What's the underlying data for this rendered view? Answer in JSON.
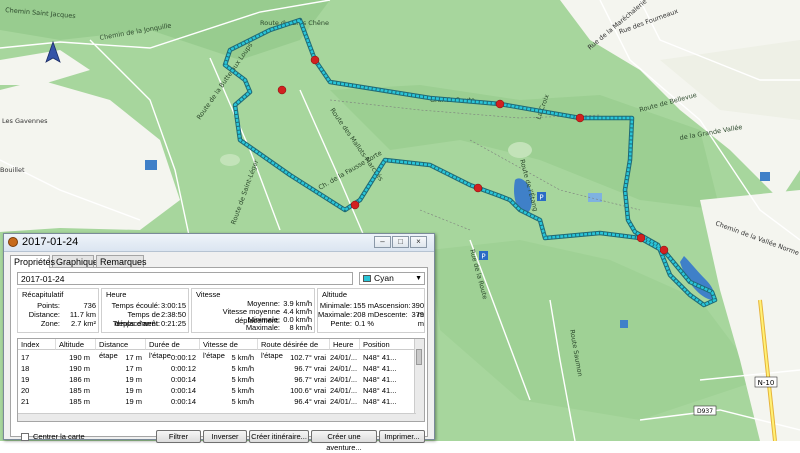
{
  "map": {
    "labels": {
      "saint_jacques": "Chemin Saint Jacques",
      "jonquilles": "Chemin de la Jonquille",
      "route_nord": "Route du Gros Chêne",
      "rue_martrelle": "Rue de la Maréchalerie",
      "rue_fourneaux": "Rue des Fourneaux",
      "route_marche": "Route des Mallots-Marchés",
      "butte_aux_loups": "Route de la Butte aux Loups",
      "fausse_porte": "Ch. de la Fausse Porte",
      "route_bellevue": "Route de Bellevue",
      "chemin_vallee": "Chemin de la Vallée Norme",
      "route_saint_leger": "Route de Saint-Léger",
      "la_croix": "La Croix",
      "route_etang": "Route de l'Étang",
      "gde_route": "Grande Route",
      "saumonne": "Route Saumon",
      "grand_vaux": "de la Grande Vallée",
      "rue_route": "Rue de la Route",
      "les_gavennes": "Les Gavennes",
      "bouillet": "Bouillet",
      "n10": "N-10",
      "d937": "D937"
    }
  },
  "window": {
    "title": "2017-01-24",
    "buttons": {
      "minimize": "–",
      "maximize": "□",
      "close": "×"
    },
    "tabs": [
      "Propriétés",
      "Graphique",
      "Remarques"
    ],
    "name_value": "2017-01-24",
    "color": {
      "label": "Cyan",
      "swatch": "#29c5d8"
    }
  },
  "summary": {
    "recap": {
      "title": "Récapitulatif",
      "rows": [
        {
          "label": "Points:",
          "value": "736"
        },
        {
          "label": "Distance:",
          "value": "11.7 km"
        },
        {
          "label": "Zone:",
          "value": "2.7 km²"
        }
      ]
    },
    "time": {
      "title": "Heure",
      "rows": [
        {
          "label": "Temps écoulé:",
          "value": "3:00:15"
        },
        {
          "label": "Temps de déplacement:",
          "value": "2:38:50"
        },
        {
          "label": "Temps d'arrêt:",
          "value": "0:21:25"
        }
      ]
    },
    "speed": {
      "title": "Vitesse",
      "rows": [
        {
          "label": "Moyenne:",
          "value": "3.9 km/h"
        },
        {
          "label": "Vitesse moyenne déplacement:",
          "value": "4.4 km/h"
        },
        {
          "label": "Minimale:",
          "value": "0.0 km/h"
        },
        {
          "label": "Maximale:",
          "value": "8 km/h"
        }
      ]
    },
    "altitude": {
      "title": "Altitude",
      "rows": [
        {
          "label": "Minimale:",
          "value": "155 m",
          "label2": "Ascension:",
          "value2": "390 m"
        },
        {
          "label": "Maximale:",
          "value": "208 m",
          "label2": "Descente:",
          "value2": "379 m"
        },
        {
          "label": "Pente:",
          "value": "0.1 %"
        }
      ]
    }
  },
  "table": {
    "headers": [
      "Index",
      "Altitude",
      "Distance étape",
      "Durée de l'étape",
      "Vitesse de l'étape",
      "Route désirée de l'étape",
      "Heure",
      "Position"
    ],
    "rows": [
      [
        "17",
        "190 m",
        "17 m",
        "0:00:12",
        "5 km/h",
        "102.7° vrai",
        "24/01/...",
        "N48° 41..."
      ],
      [
        "18",
        "190 m",
        "17 m",
        "0:00:12",
        "5 km/h",
        "96.7° vrai",
        "24/01/...",
        "N48° 41..."
      ],
      [
        "19",
        "186 m",
        "19 m",
        "0:00:14",
        "5 km/h",
        "96.7° vrai",
        "24/01/...",
        "N48° 41..."
      ],
      [
        "20",
        "185 m",
        "19 m",
        "0:00:14",
        "5 km/h",
        "100.6° vrai",
        "24/01/...",
        "N48° 41..."
      ],
      [
        "21",
        "185 m",
        "19 m",
        "0:00:14",
        "5 km/h",
        "96.4° vrai",
        "24/01/...",
        "N48° 41..."
      ]
    ]
  },
  "footer": {
    "center_map": "Centrer la carte",
    "filter": "Filtrer",
    "invert": "Inverser",
    "create_route": "Créer itinéraire...",
    "create_adventure": "Créer une aventure...",
    "print": "Imprimer..."
  },
  "colors": {
    "forest": "#a3d59a",
    "open_land": "#f4f5ef",
    "track": "#29c5d8",
    "water": "#3f80c8"
  }
}
